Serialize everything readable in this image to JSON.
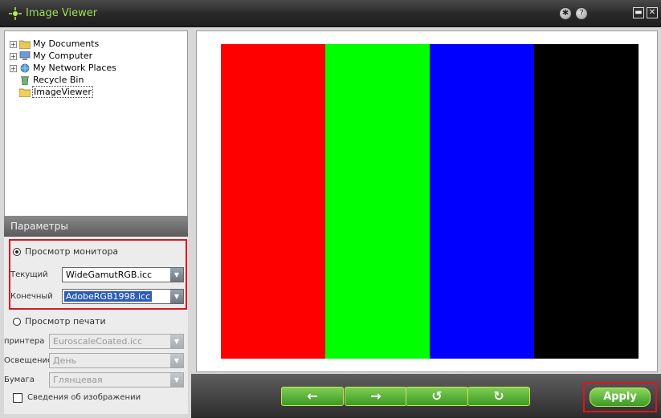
{
  "window": {
    "title": "Image Viewer",
    "settings_icon": "gear-icon",
    "help_label": "?",
    "minimize_icon": "minimize-icon",
    "close_icon": "close-icon"
  },
  "tree": [
    {
      "label": "My Documents",
      "icon": "documents-folder-icon",
      "expander": "+",
      "color": "#e8c75a"
    },
    {
      "label": "My Computer",
      "icon": "computer-icon",
      "expander": "+",
      "color": "#6e9bd8"
    },
    {
      "label": "My Network Places",
      "icon": "network-icon",
      "expander": "+",
      "color": "#5b9ad6"
    },
    {
      "label": "Recycle Bin",
      "icon": "recycle-bin-icon",
      "expander": "",
      "color": "#6fb47a"
    },
    {
      "label": "ImageViewer",
      "icon": "folder-icon",
      "expander": "",
      "color": "#f1cf5e"
    }
  ],
  "params": {
    "header": "Параметры",
    "monitor_view_label": "Просмотр монитора",
    "current_label": "Текущий",
    "current_value": "WideGamutRGB.icc",
    "target_label": "Конечный",
    "target_value": "AdobeRGB1998.icc",
    "print_view_label": "Просмотр печати",
    "printer_label": "принтера",
    "printer_value": "EuroscaleCoated.icc",
    "lighting_label": "Освещение",
    "lighting_value": "День",
    "paper_label": "Бумага",
    "paper_value": "Глянцевая",
    "image_info_label": "Сведения об изображении"
  },
  "canvas_colors": [
    "#ff0000",
    "#00ff00",
    "#0000ff",
    "#000000"
  ],
  "toolbar": {
    "prev_label": "←",
    "next_label": "→",
    "rotate_left_label": "↺",
    "rotate_right_label": "↻",
    "apply_label": "Apply"
  }
}
